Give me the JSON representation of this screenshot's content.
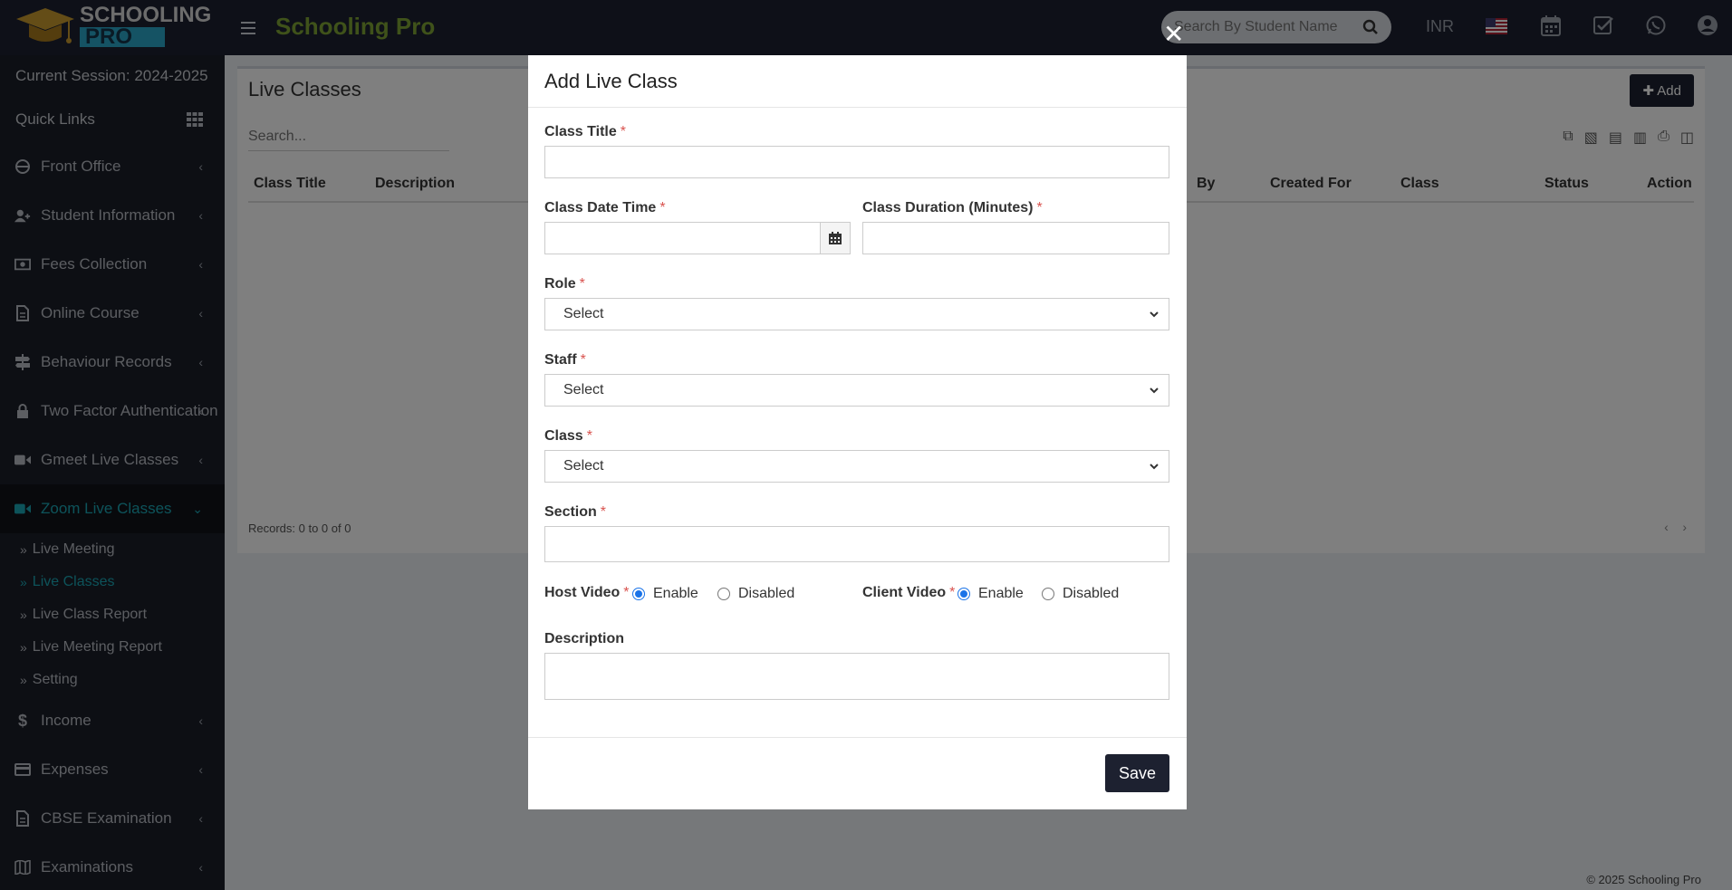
{
  "header": {
    "logo_top": "SCHOOLING",
    "logo_bottom": "PRO",
    "brand": "Schooling Pro",
    "search_placeholder": "Search By Student Name",
    "currency": "INR"
  },
  "sidebar": {
    "session": "Current Session: 2024-2025",
    "quick_links": "Quick Links",
    "items_top": [
      {
        "label": "Front Office",
        "icon": "monitor-icon"
      },
      {
        "label": "Student Information",
        "icon": "user-plus-icon"
      },
      {
        "label": "Fees Collection",
        "icon": "money-icon"
      },
      {
        "label": "Online Course",
        "icon": "document-icon"
      },
      {
        "label": "Behaviour Records",
        "icon": "signpost-icon"
      },
      {
        "label": "Two Factor Authentication",
        "icon": "lock-icon"
      },
      {
        "label": "Gmeet Live Classes",
        "icon": "video-icon"
      },
      {
        "label": "Zoom Live Classes",
        "icon": "video-icon"
      }
    ],
    "sub_items": [
      "Live Meeting",
      "Live Classes",
      "Live Class Report",
      "Live Meeting Report",
      "Setting"
    ],
    "items_bottom": [
      {
        "label": "Income",
        "icon": "dollar-icon"
      },
      {
        "label": "Expenses",
        "icon": "card-icon"
      },
      {
        "label": "CBSE Examination",
        "icon": "document-icon"
      },
      {
        "label": "Examinations",
        "icon": "map-icon"
      }
    ]
  },
  "page": {
    "title": "Live Classes",
    "add_label": "Add",
    "search_placeholder": "Search...",
    "columns": [
      "Class Title",
      "Description",
      "By",
      "Created For",
      "Class",
      "Status",
      "Action"
    ],
    "records": "Records: 0 to 0 of 0",
    "footer": "© 2025 Schooling Pro"
  },
  "modal": {
    "title": "Add Live Class",
    "class_title_label": "Class Title",
    "class_datetime_label": "Class Date Time",
    "class_duration_label": "Class Duration (Minutes)",
    "role_label": "Role",
    "role_value": "Select",
    "staff_label": "Staff",
    "staff_value": "Select",
    "class_label": "Class",
    "class_value": "Select",
    "section_label": "Section",
    "host_video_label": "Host Video",
    "client_video_label": "Client Video",
    "enable_label": "Enable",
    "disabled_label": "Disabled",
    "description_label": "Description",
    "required_mark": "*",
    "save_label": "Save",
    "host_video_selected": "Enable",
    "client_video_selected": "Enable"
  },
  "colors": {
    "header_bg": "#1d2130",
    "sidebar_bg": "#1b1e28",
    "active_accent": "#1aa6b5",
    "brand_green": "#7ea434",
    "required_red": "#d9534f",
    "radio_blue": "#1a73e8"
  }
}
